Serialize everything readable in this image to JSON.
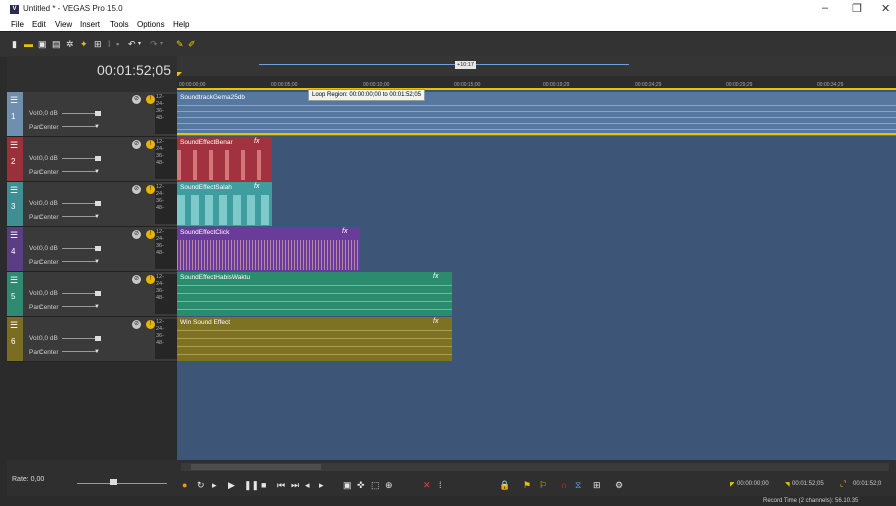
{
  "window": {
    "title": "Untitled * - VEGAS Pro 15.0",
    "app_icon_letter": "V",
    "minimize": "–",
    "maximize": "❐",
    "close": "✕"
  },
  "menu": [
    "File",
    "Edit",
    "View",
    "Insert",
    "Tools",
    "Options",
    "Help"
  ],
  "timecode": "00:01:52;05",
  "ruler": {
    "ticks": [
      "00:00:00;00",
      "00:00:05;00",
      "00:00:10;00",
      "00:00:15;00",
      "00:00:19;29",
      "00:00:24;29",
      "00:00:29;29",
      "00:00:34;29"
    ],
    "range_marker": "+10:17",
    "loop_tooltip": "Loop Region: 00:00:00;00 to 00:01:52;05"
  },
  "tracks": [
    {
      "num": "1",
      "vol_label": "Vol:",
      "vol": "0,0 dB",
      "pan_label": "Pan:",
      "pan": "Center",
      "color": "#6e8fae",
      "event": "SoundtrackGema25db",
      "event_color": "#5677a0",
      "fx": ""
    },
    {
      "num": "2",
      "vol_label": "Vol:",
      "vol": "0,0 dB",
      "pan_label": "Pan:",
      "pan": "Center",
      "color": "#9b2f3a",
      "event": "SoundEffectBenar",
      "event_color": "#a2323f",
      "fx": "fx"
    },
    {
      "num": "3",
      "vol_label": "Vol:",
      "vol": "0,0 dB",
      "pan_label": "Pan:",
      "pan": "Center",
      "color": "#3d8f93",
      "event": "SoundEffectSalah",
      "event_color": "#3f9da0",
      "fx": "fx"
    },
    {
      "num": "4",
      "vol_label": "Vol:",
      "vol": "0,0 dB",
      "pan_label": "Pan:",
      "pan": "Center",
      "color": "#5b3d86",
      "event": "SoundEffectClick",
      "event_color": "#6a3c9a",
      "fx": "fx"
    },
    {
      "num": "5",
      "vol_label": "Vol:",
      "vol": "0,0 dB",
      "pan_label": "Pan:",
      "pan": "Center",
      "color": "#2f8a72",
      "event": "SoundEffectHabisWaktu",
      "event_color": "#2b8b6f",
      "fx": "fx"
    },
    {
      "num": "6",
      "vol_label": "Vol:",
      "vol": "0,0 dB",
      "pan_label": "Pan:",
      "pan": "Center",
      "color": "#7a6d22",
      "event": "Win Sound Effect",
      "event_color": "#7d7124",
      "fx": "fx"
    }
  ],
  "meter_ticks": [
    "12-",
    "24-",
    "36-",
    "48-"
  ],
  "rate": "Rate: 0,00",
  "transport_times": {
    "start": "00:00:00;00",
    "end": "00:01:52;05",
    "length": "00:01:52;0"
  },
  "status": "Record Time (2 channels): 56.10.35",
  "colors": {
    "accent": "#e8c400",
    "timeline_bg": "#3d5677"
  }
}
